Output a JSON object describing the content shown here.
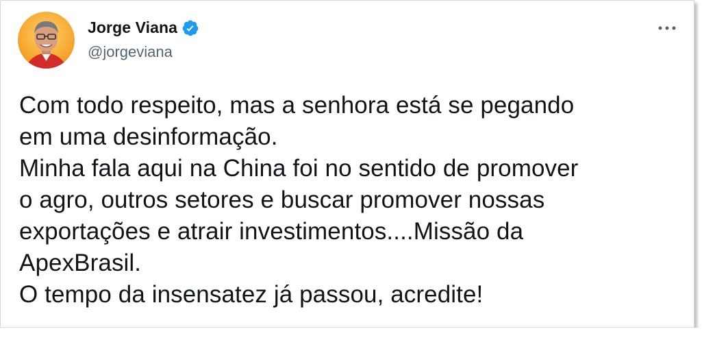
{
  "author": {
    "display_name": "Jorge Viana",
    "handle": "@jorgeviana",
    "verified": true,
    "verified_color": "#1d9bf0"
  },
  "tweet": {
    "text": "Com todo respeito, mas a senhora está se pegando\nem uma desinformação.\nMinha fala aqui na China foi no sentido de promover\no agro, outros setores e buscar promover nossas\nexportações e atrair investimentos....Missão da\nApexBrasil.\nO tempo da insensatez já passou, acredite!"
  },
  "icons": {
    "verified": "verified-badge-icon",
    "more": "more-options-icon",
    "avatar": "profile-photo"
  },
  "colors": {
    "avatar_ring": "#f5a623",
    "text_primary": "#0f1419",
    "text_secondary": "#536471"
  }
}
